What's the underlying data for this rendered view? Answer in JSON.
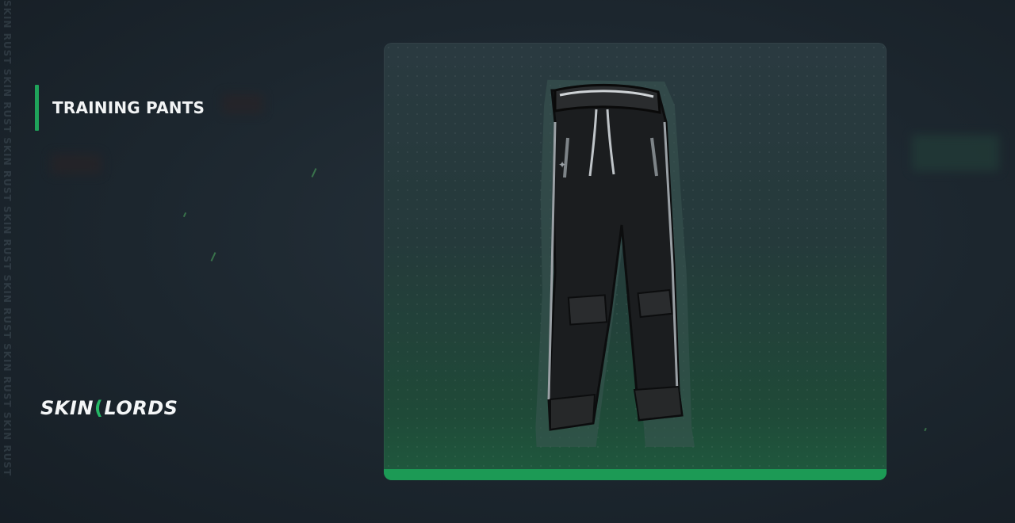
{
  "item": {
    "title": "TRAINING PANTS"
  },
  "brand": {
    "logo_left": "SKIN",
    "logo_right": "LORDS",
    "watermark_text": "SKIN RUST SKIN RUST SKIN RUST SKIN RUST SKIN RUST SKIN RUST SKIN RUST"
  },
  "colors": {
    "accent": "#1fa35a",
    "card_bottom_bar": "#1c9a55",
    "background": "#1c262e"
  },
  "icons": {
    "item_image": "training-pants-icon"
  }
}
